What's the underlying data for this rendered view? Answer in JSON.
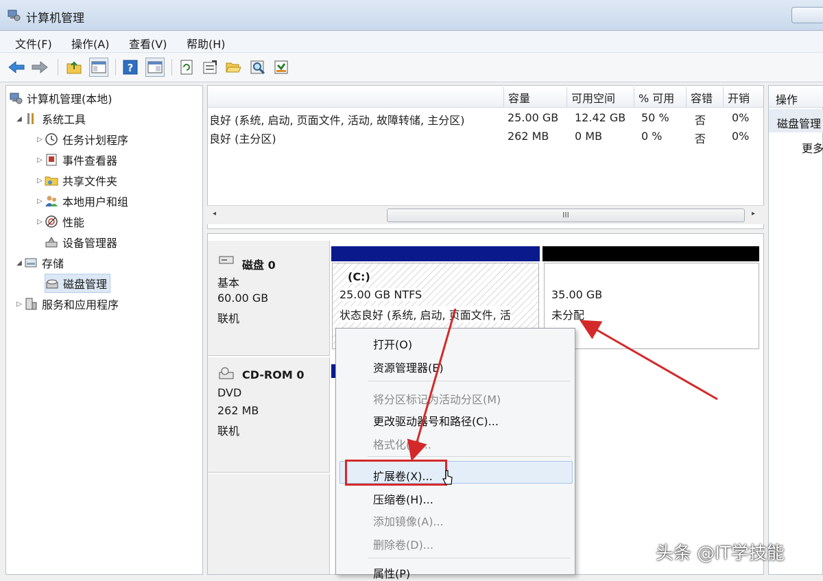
{
  "window": {
    "title": "计算机管理"
  },
  "menu": [
    "文件(F)",
    "操作(A)",
    "查看(V)",
    "帮助(H)"
  ],
  "toolbar_icons": [
    "back-icon",
    "forward-icon",
    "up-folder-icon",
    "show-hide-tree-icon",
    "help-icon",
    "view-icon",
    "refresh-icon",
    "properties-icon",
    "open-folder-icon",
    "search-icon",
    "export-icon"
  ],
  "tree": {
    "root": "计算机管理(本地)",
    "system_tools": "系统工具",
    "task_scheduler": "任务计划程序",
    "event_viewer": "事件查看器",
    "shared_folders": "共享文件夹",
    "local_users": "本地用户和组",
    "performance": "性能",
    "device_manager": "设备管理器",
    "storage": "存储",
    "disk_management": "磁盘管理",
    "services_apps": "服务和应用程序"
  },
  "volume_table": {
    "columns": [
      "容量",
      "可用空间",
      "% 可用",
      "容错",
      "开销"
    ],
    "rows": [
      {
        "status": "良好 (系统, 启动, 页面文件, 活动, 故障转储, 主分区)",
        "capacity": "25.00 GB",
        "free": "12.42 GB",
        "pct": "50 %",
        "fault": "否",
        "overhead": "0%"
      },
      {
        "status": "良好 (主分区)",
        "capacity": "262 MB",
        "free": "0 MB",
        "pct": "0 %",
        "fault": "否",
        "overhead": "0%"
      }
    ],
    "scroll_glyph": "III"
  },
  "actions": {
    "header": "操作",
    "selected": "磁盘管理",
    "more": "更多"
  },
  "disks": {
    "disk0": {
      "name": "磁盘 0",
      "type": "基本",
      "size": "60.00 GB",
      "state": "联机"
    },
    "c_part": {
      "name": "(C:)",
      "size": "25.00 GB NTFS",
      "status": "状态良好 (系统, 启动, 页面文件, 活"
    },
    "unalloc": {
      "size": "35.00 GB",
      "label": "未分配"
    },
    "cdrom": {
      "name": "CD-ROM 0",
      "type": "DVD",
      "size": "262 MB",
      "state": "联机"
    }
  },
  "context_menu": [
    {
      "label": "打开(O)",
      "enabled": true
    },
    {
      "label": "资源管理器(E)",
      "enabled": true
    },
    {
      "label": "将分区标记为活动分区(M)",
      "enabled": false
    },
    {
      "label": "更改驱动器号和路径(C)...",
      "enabled": true
    },
    {
      "label": "格式化(F)...",
      "enabled": false
    },
    {
      "label": "扩展卷(X)...",
      "enabled": true
    },
    {
      "label": "压缩卷(H)...",
      "enabled": true
    },
    {
      "label": "添加镜像(A)...",
      "enabled": false
    },
    {
      "label": "删除卷(D)...",
      "enabled": false
    },
    {
      "label": "属性(P)",
      "enabled": true
    }
  ],
  "watermark": "头条 @IT学技能",
  "colors": {
    "disk_bar_blue": "#0a1a8c",
    "unalloc_bar": "#000000",
    "annotation_red": "#d4292a"
  }
}
